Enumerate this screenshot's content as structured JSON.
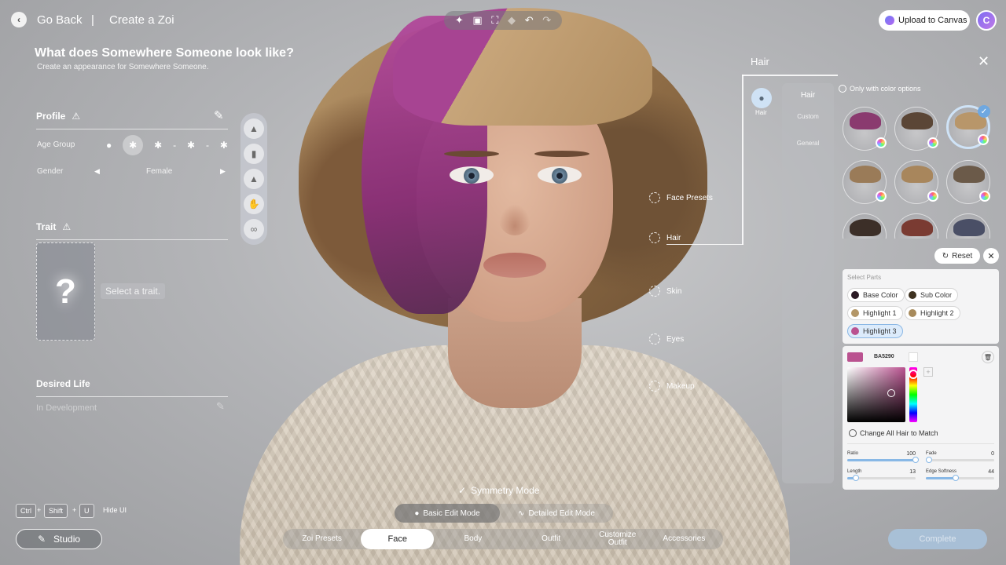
{
  "topbar": {
    "go_back": "Go Back",
    "separator": "|",
    "breadcrumb": "Create a Zoi",
    "upload_label": "Upload to Canvas",
    "tools": [
      "sparkle-icon",
      "camera-icon",
      "focus-icon",
      "mask-icon",
      "undo-icon",
      "redo-icon"
    ]
  },
  "header": {
    "title": "What does Somewhere Someone look like?",
    "subtitle": "Create an appearance for Somewhere Someone."
  },
  "profile": {
    "heading": "Profile",
    "age_label": "Age Group",
    "age_selected_index": 1,
    "gender_label": "Gender",
    "gender_value": "Female"
  },
  "trait": {
    "heading": "Trait",
    "placeholder_glyph": "?",
    "hint": "Select a trait."
  },
  "desired_life": {
    "heading": "Desired Life",
    "status": "In Development"
  },
  "hotkeys": {
    "keys": [
      "Ctrl",
      "Shift",
      "U"
    ],
    "plus": "+",
    "label": "Hide UI"
  },
  "studio_label": "Studio",
  "symmetry_label": "Symmetry Mode",
  "modes": {
    "basic": "Basic Edit Mode",
    "detailed": "Detailed Edit Mode"
  },
  "tabs": [
    "Zoi Presets",
    "Face",
    "Body",
    "Outfit",
    "Customize Outfit",
    "Accessories"
  ],
  "active_tab": "Face",
  "complete_label": "Complete",
  "hotspots": [
    "Face Presets",
    "Hair",
    "Skin",
    "Eyes",
    "Makeup"
  ],
  "hair_panel": {
    "title": "Hair",
    "category": "Hair",
    "subnav": [
      "Hair",
      "Custom",
      "General"
    ],
    "color_options_label": "Only with color options",
    "reset_label": "Reset",
    "select_parts_label": "Select Parts",
    "parts": [
      {
        "label": "Base Color",
        "color": "#2b1a24"
      },
      {
        "label": "Sub Color",
        "color": "#3f3220"
      },
      {
        "label": "Highlight 1",
        "color": "#b49768"
      },
      {
        "label": "Highlight 2",
        "color": "#a88b5c"
      },
      {
        "label": "Highlight 3",
        "color": "#BA5290"
      }
    ],
    "selected_part": "Highlight 3",
    "hex_value": "BA5290",
    "match_label": "Change All Hair to Match",
    "sliders": [
      {
        "name": "Ratio",
        "value": 100,
        "max": 100
      },
      {
        "name": "Fade",
        "value": 0,
        "max": 100
      },
      {
        "name": "Length",
        "value": 13,
        "max": 100
      },
      {
        "name": "Edge Softness",
        "value": 44,
        "max": 100
      }
    ],
    "swatch_caps": [
      "#8a3a6f",
      "#5b4636",
      "#b8966a",
      "#9a7b58",
      "#a8865c",
      "#6b5a49",
      "#3c2f28",
      "#7a3b32",
      "#4a4f66"
    ],
    "selected_swatch_index": 2
  },
  "colors": {
    "accent": "#6fa8e0",
    "highlight": "#BA5290"
  }
}
